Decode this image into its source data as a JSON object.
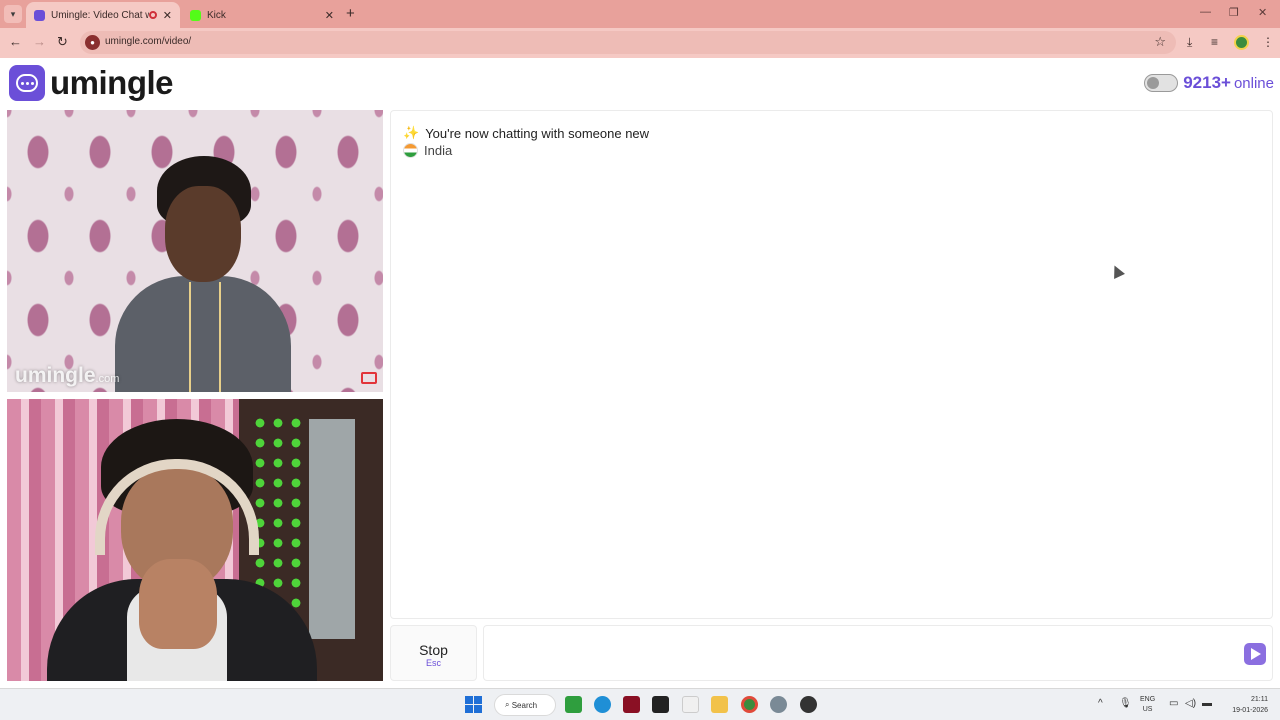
{
  "browser": {
    "tabs": [
      {
        "title": "Umingle: Video Chat with S",
        "active": true,
        "favicon_color": "#6b4fd8",
        "recording": true
      },
      {
        "title": "Kick",
        "active": false,
        "favicon_color": "#53fc18"
      }
    ],
    "url": "umingle.com/video/"
  },
  "header": {
    "logo_text": "umingle",
    "online_count": "9213+",
    "online_label": "online"
  },
  "videos": {
    "remote_watermark": "umingle",
    "remote_watermark_suffix": ".com"
  },
  "chat": {
    "system_message": "You're now chatting with someone new",
    "country": "India"
  },
  "controls": {
    "stop_label": "Stop",
    "stop_key": "Esc",
    "message_placeholder": ""
  },
  "taskbar": {
    "search_label": "Search",
    "language": "ENG",
    "region": "US",
    "time": "21:11",
    "date": "19-01-2026"
  },
  "colors": {
    "brand": "#6b4fd8",
    "browser_frame": "#e8a19b"
  }
}
